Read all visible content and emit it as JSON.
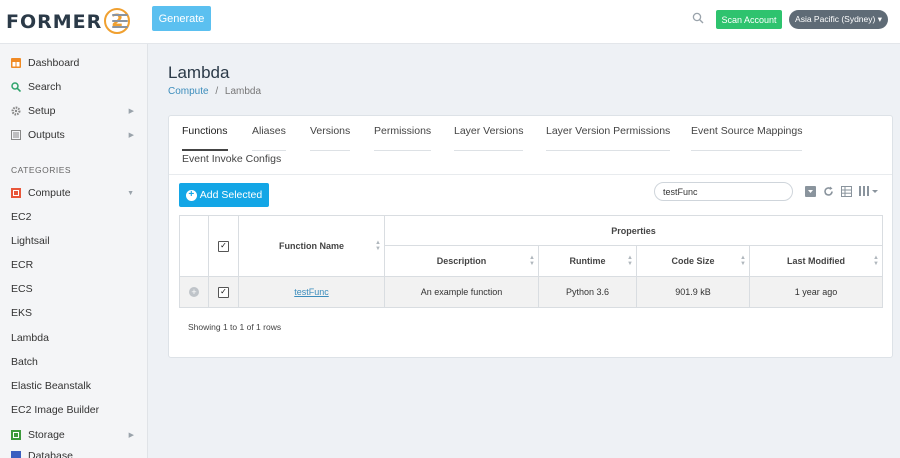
{
  "header": {
    "logo_text": "FORMER",
    "logo_badge": "2",
    "generate_label": "Generate",
    "scan_label": "Scan Account",
    "region_label": "Asia Pacific (Sydney) ▾"
  },
  "sidebar": {
    "top_items": [
      {
        "label": "Dashboard",
        "icon": "dashboard-icon",
        "color": "#f08a24"
      },
      {
        "label": "Search",
        "icon": "search-icon",
        "color": "#2ea36b"
      },
      {
        "label": "Setup",
        "icon": "gear-icon",
        "color": "#888888",
        "caret": "▶"
      },
      {
        "label": "Outputs",
        "icon": "outputs-icon",
        "color": "#888888",
        "caret": "▶"
      }
    ],
    "categories_heading": "CATEGORIES",
    "compute": {
      "label": "Compute",
      "icon": "compute-icon",
      "color": "#e8563a",
      "caret": "▼"
    },
    "services": [
      "EC2",
      "Lightsail",
      "ECR",
      "ECS",
      "EKS",
      "Lambda",
      "Batch",
      "Elastic Beanstalk",
      "EC2 Image Builder"
    ],
    "storage": {
      "label": "Storage",
      "icon": "storage-icon",
      "color": "#3c9a3c",
      "caret": "▶"
    },
    "database": {
      "label": "Database",
      "icon": "database-icon",
      "color": "#3b5fc0"
    }
  },
  "main": {
    "title": "Lambda",
    "breadcrumb": {
      "root": "Compute",
      "sep": "/",
      "current": "Lambda"
    }
  },
  "tabs": [
    "Functions",
    "Aliases",
    "Versions",
    "Permissions",
    "Layer Versions",
    "Layer Version Permissions",
    "Event Source Mappings",
    "Event Invoke Configs"
  ],
  "toolbar": {
    "add_selected": "Add Selected",
    "add_plus": "+",
    "filter_value": "testFunc"
  },
  "table": {
    "group_header": "Properties",
    "columns": {
      "name": "Function Name",
      "description": "Description",
      "runtime": "Runtime",
      "code_size": "Code Size",
      "last_modified": "Last Modified"
    },
    "check_mark": "✓",
    "expand_mark": "+",
    "rows": [
      {
        "name": "testFunc",
        "description": "An example function",
        "runtime": "Python 3.6",
        "code_size": "901.9 kB",
        "last_modified": "1 year ago"
      }
    ],
    "footer": "Showing 1 to 1 of 1 rows"
  },
  "sort_glyph": "▲▼"
}
